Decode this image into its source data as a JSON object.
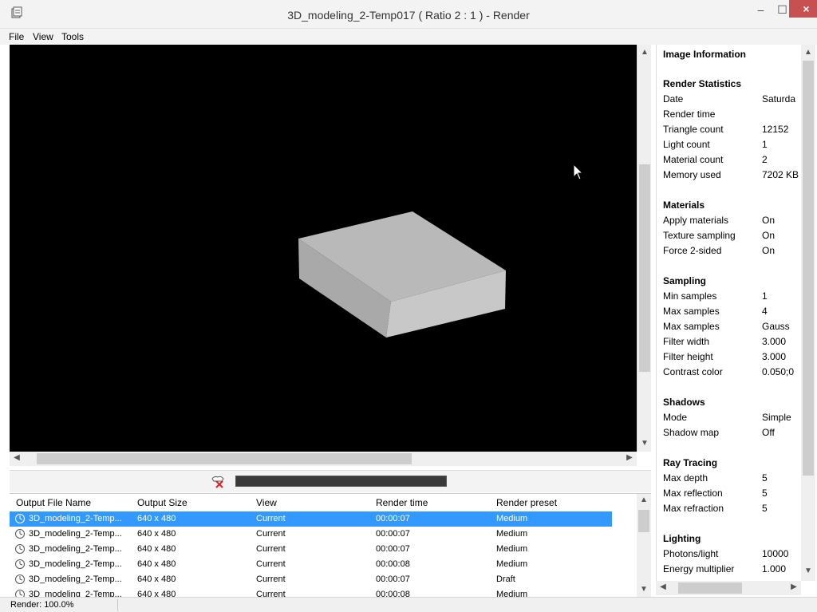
{
  "window": {
    "title": "3D_modeling_2-Temp017  ( Ratio 2 : 1 ) - Render",
    "minimize": "–",
    "maximize": "☐",
    "close": "×"
  },
  "menu": {
    "file": "File",
    "view": "View",
    "tools": "Tools"
  },
  "render_progress": 1.0,
  "table": {
    "headers": [
      "Output File Name",
      "Output Size",
      "View",
      "Render time",
      "Render preset"
    ],
    "rows": [
      [
        "3D_modeling_2-Temp...",
        "640 x 480",
        "Current",
        "00:00:07",
        "Medium"
      ],
      [
        "3D_modeling_2-Temp...",
        "640 x 480",
        "Current",
        "00:00:07",
        "Medium"
      ],
      [
        "3D_modeling_2-Temp...",
        "640 x 480",
        "Current",
        "00:00:07",
        "Medium"
      ],
      [
        "3D_modeling_2-Temp...",
        "640 x 480",
        "Current",
        "00:00:08",
        "Medium"
      ],
      [
        "3D_modeling_2-Temp...",
        "640 x 480",
        "Current",
        "00:00:07",
        "Draft"
      ],
      [
        "3D_modeling_2-Temp...",
        "640 x 480",
        "Current",
        "00:00:08",
        "Medium"
      ]
    ]
  },
  "status": {
    "text": "Render: 100.0%"
  },
  "info": {
    "title": "Image Information",
    "sections": [
      {
        "name": "Render Statistics",
        "items": [
          [
            "Date",
            "Saturda"
          ],
          [
            "Render time",
            ""
          ],
          [
            "Triangle count",
            "12152"
          ],
          [
            "Light count",
            "1"
          ],
          [
            "Material count",
            "2"
          ],
          [
            "Memory used",
            "7202 KB"
          ]
        ]
      },
      {
        "name": "Materials",
        "items": [
          [
            "Apply materials",
            "On"
          ],
          [
            "Texture sampling",
            "On"
          ],
          [
            "Force 2-sided",
            "On"
          ]
        ]
      },
      {
        "name": "Sampling",
        "items": [
          [
            "Min samples",
            "1"
          ],
          [
            "Max samples",
            "4"
          ],
          [
            "Max samples",
            "Gauss"
          ],
          [
            "Filter width",
            "3.000"
          ],
          [
            "Filter height",
            "3.000"
          ],
          [
            "Contrast color",
            "0.050;0"
          ]
        ]
      },
      {
        "name": "Shadows",
        "items": [
          [
            "Mode",
            "Simple"
          ],
          [
            "Shadow map",
            "Off"
          ]
        ]
      },
      {
        "name": "Ray Tracing",
        "items": [
          [
            "Max depth",
            "5"
          ],
          [
            "Max reflection",
            "5"
          ],
          [
            "Max refraction",
            "5"
          ]
        ]
      },
      {
        "name": "Lighting",
        "items": [
          [
            "Photons/light",
            "10000"
          ],
          [
            "Energy multiplier",
            "1.000"
          ]
        ]
      }
    ]
  },
  "colors": {
    "selection": "#3399ff",
    "close_button": "#c75050"
  }
}
